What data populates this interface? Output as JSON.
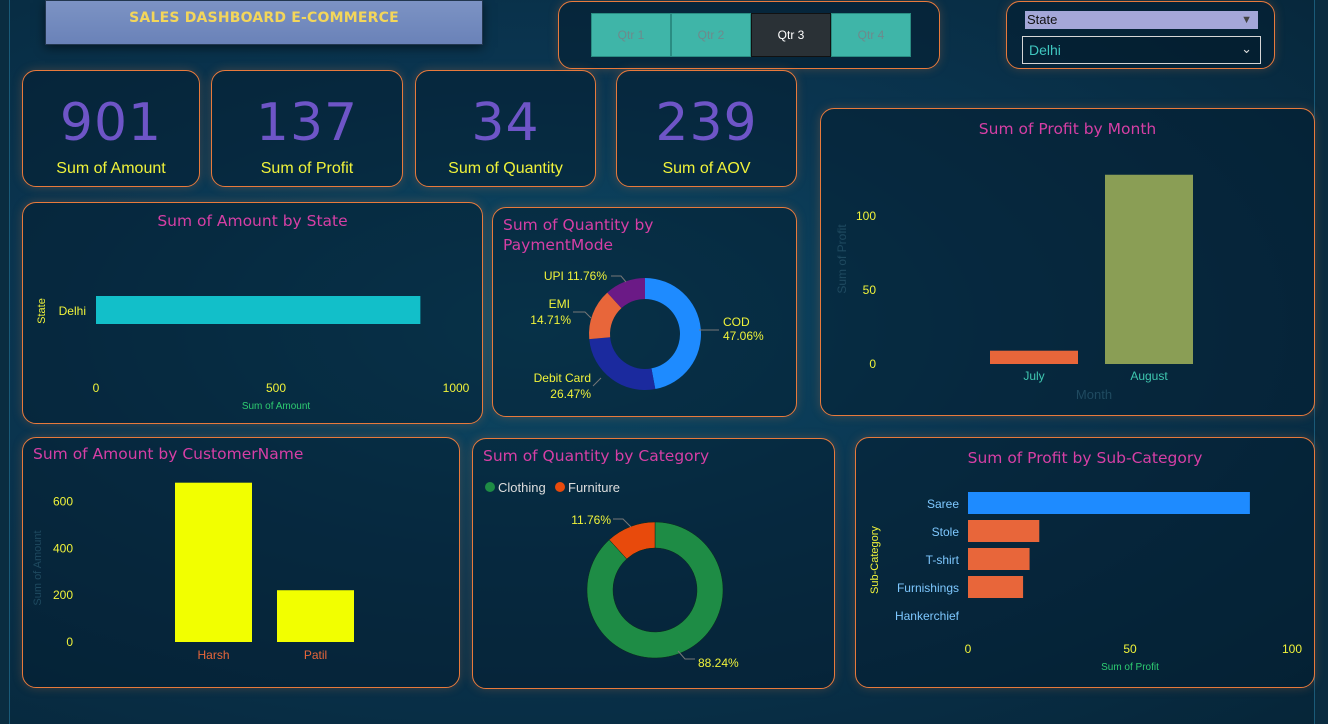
{
  "title": "SALES DASHBOARD E-COMMERCE",
  "quarters": {
    "items": [
      "Qtr 1",
      "Qtr 2",
      "Qtr 3",
      "Qtr 4"
    ],
    "selected": "Qtr 3"
  },
  "state_slicer": {
    "header": "State",
    "value": "Delhi"
  },
  "kpis": [
    {
      "value": "901",
      "label": "Sum of Amount"
    },
    {
      "value": "137",
      "label": "Sum of Profit"
    },
    {
      "value": "34",
      "label": "Sum of Quantity"
    },
    {
      "value": "239",
      "label": "Sum of AOV"
    }
  ],
  "colors": {
    "panel_border": "#e87a3c",
    "chart_title": "#d63fa5",
    "kpi_value": "#6e55c7",
    "kpi_label": "#f0f33a",
    "axis_text": "#f0f33a"
  },
  "chart_data": [
    {
      "id": "amount_by_state",
      "type": "bar",
      "orientation": "horizontal",
      "title": "Sum of Amount by State",
      "xlabel": "Sum of Amount",
      "ylabel": "State",
      "categories": [
        "Delhi"
      ],
      "values": [
        901
      ],
      "xlim": [
        0,
        1000
      ],
      "xticks": [
        "0",
        "500",
        "1000"
      ],
      "color": "#12bfc9"
    },
    {
      "id": "quantity_by_paymentmode",
      "type": "pie",
      "donut": true,
      "title": "Sum of Quantity by PaymentMode",
      "slices": [
        {
          "label": "COD",
          "percent_label": "47.06%",
          "value": 47.06,
          "color": "#1e8bff"
        },
        {
          "label": "Debit Card",
          "percent_label": "26.47%",
          "value": 26.47,
          "color": "#1b2a9e"
        },
        {
          "label": "EMI",
          "percent_label": "14.71%",
          "value": 14.71,
          "color": "#e8663a"
        },
        {
          "label": "UPI",
          "percent_label": "11.76%",
          "value": 11.76,
          "color": "#6b1a86"
        }
      ]
    },
    {
      "id": "profit_by_month",
      "type": "bar",
      "title": "Sum of Profit by Month",
      "xlabel": "Month",
      "ylabel": "Sum of Profit",
      "categories": [
        "July",
        "August"
      ],
      "values": [
        9,
        128
      ],
      "colors": [
        "#e8663a",
        "#8a9e55"
      ],
      "ylim": [
        0,
        140
      ],
      "yticks": [
        "0",
        "50",
        "100"
      ]
    },
    {
      "id": "amount_by_customer",
      "type": "bar",
      "title": "Sum of Amount by CustomerName",
      "xlabel": "",
      "ylabel": "Sum of Amount",
      "categories": [
        "Harsh",
        "Patil"
      ],
      "values": [
        680,
        221
      ],
      "color": "#f2ff00",
      "ylim": [
        0,
        700
      ],
      "yticks": [
        "0",
        "200",
        "400",
        "600"
      ]
    },
    {
      "id": "quantity_by_category",
      "type": "pie",
      "donut": true,
      "title": "Sum of Quantity by Category",
      "legend": [
        "Clothing",
        "Furniture"
      ],
      "slices": [
        {
          "label": "Clothing",
          "percent_label": "88.24%",
          "value": 88.24,
          "color": "#1e8c45"
        },
        {
          "label": "Furniture",
          "percent_label": "11.76%",
          "value": 11.76,
          "color": "#e84a0c"
        }
      ]
    },
    {
      "id": "profit_by_subcategory",
      "type": "bar",
      "orientation": "horizontal",
      "title": "Sum of Profit by Sub-Category",
      "xlabel": "Sum of Profit",
      "ylabel": "Sub-Category",
      "categories": [
        "Saree",
        "Stole",
        "T-shirt",
        "Furnishings",
        "Hankerchief"
      ],
      "values": [
        87,
        22,
        19,
        17,
        0
      ],
      "colors": [
        "#1e8bff",
        "#e8663a",
        "#e8663a",
        "#e8663a",
        "#e8663a"
      ],
      "xlim": [
        0,
        100
      ],
      "xticks": [
        "0",
        "50",
        "100"
      ]
    }
  ]
}
